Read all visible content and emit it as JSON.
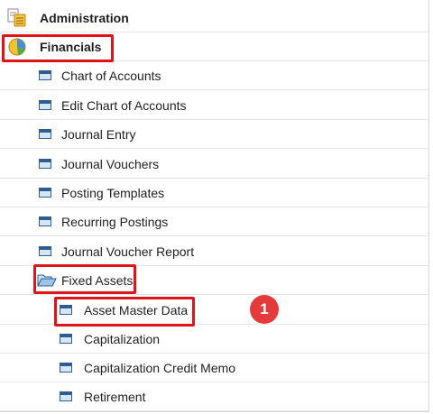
{
  "modules": {
    "administration": {
      "label": "Administration",
      "icon": "module-folder-icon"
    },
    "financials": {
      "label": "Financials",
      "icon": "pie-chart-icon"
    }
  },
  "financials_items": [
    "Chart of Accounts",
    "Edit Chart of Accounts",
    "Journal Entry",
    "Journal Vouchers",
    "Posting Templates",
    "Recurring Postings",
    "Journal Voucher Report"
  ],
  "fixed_assets": {
    "label": "Fixed Assets",
    "icon": "open-folder-icon",
    "items": [
      "Asset Master Data",
      "Capitalization",
      "Capitalization Credit Memo",
      "Retirement"
    ]
  },
  "callout": {
    "number": "1"
  },
  "colors": {
    "highlight": "#e0131b",
    "badge": "#e33b3b"
  }
}
